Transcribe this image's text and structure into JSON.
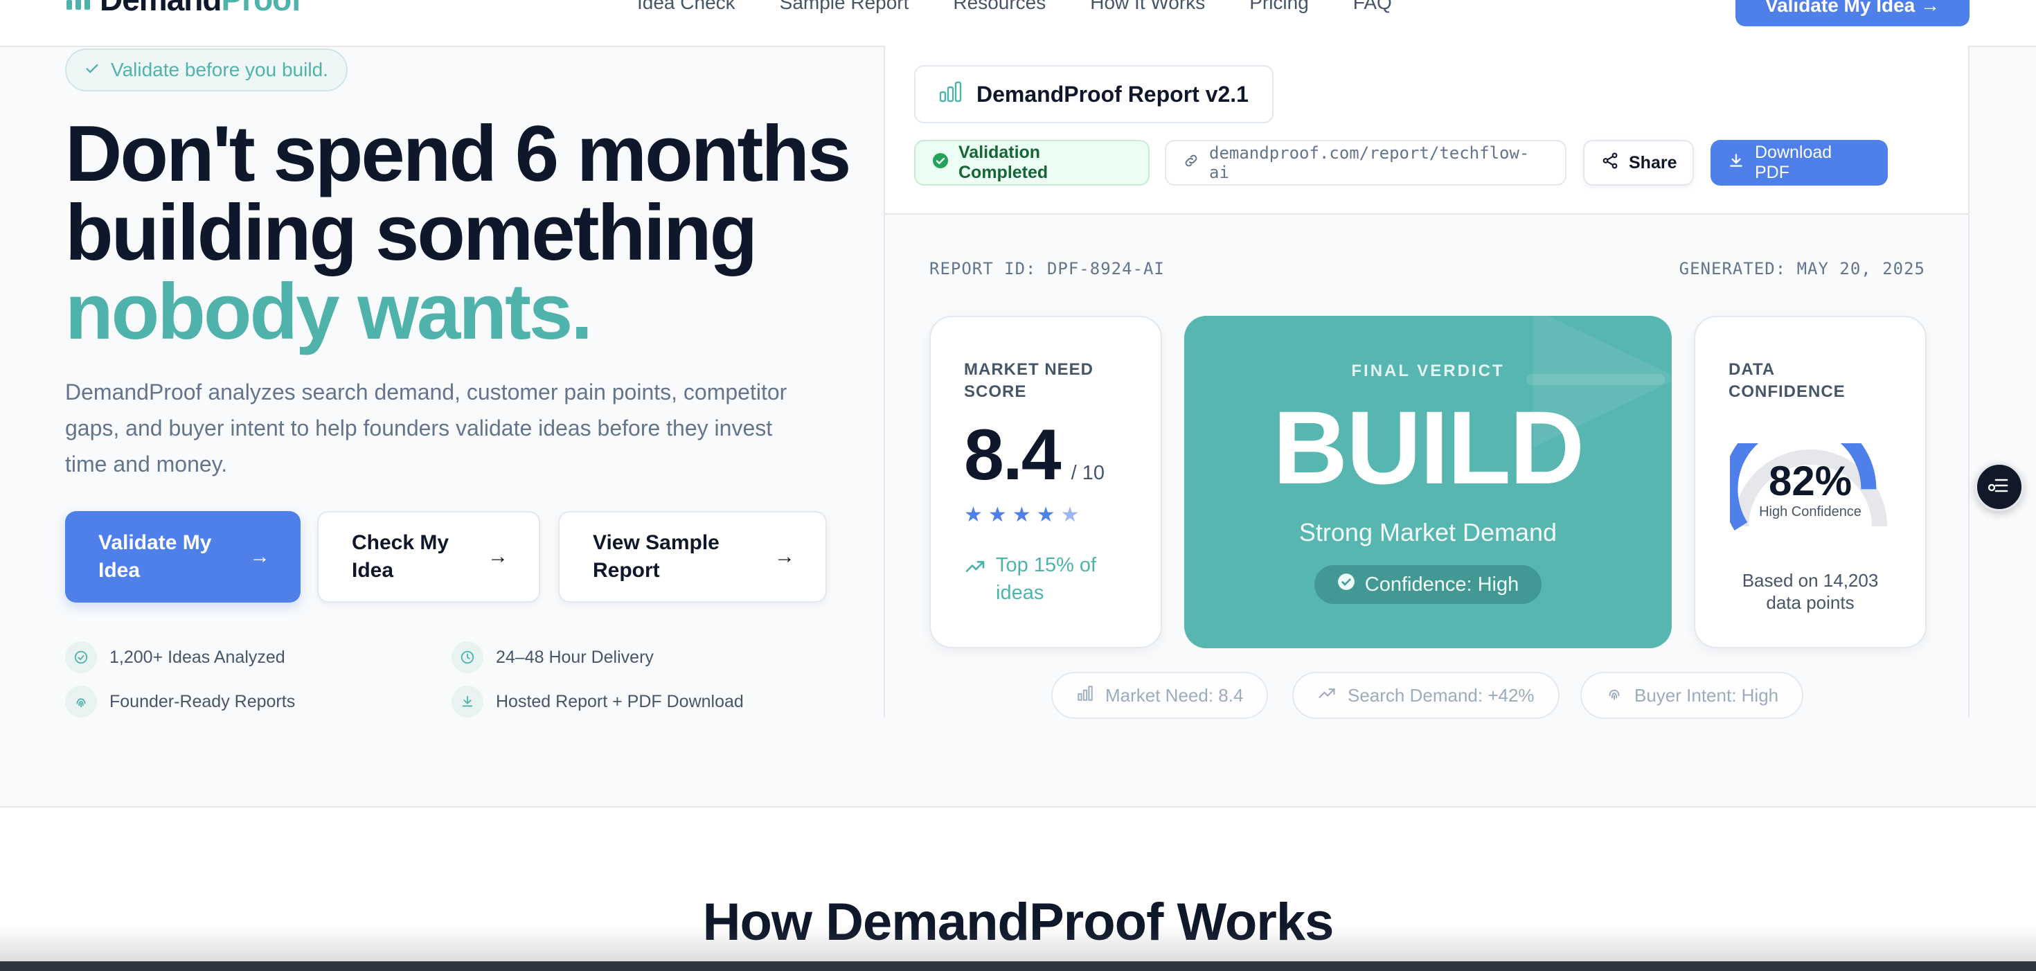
{
  "nav": {
    "brand_prefix": "Demand",
    "brand_accent": "Proof",
    "links": [
      "Idea Check",
      "Sample Report",
      "Resources",
      "How It Works",
      "Pricing",
      "FAQ"
    ],
    "cta": "Validate My Idea →"
  },
  "hero": {
    "pill": "Validate before you build.",
    "headline_line1": "Don't spend 6 months",
    "headline_line2": "building something",
    "headline_accent": "nobody wants.",
    "subcopy": "DemandProof analyzes search demand, customer pain points, competitor gaps, and buyer intent to help founders validate ideas before they invest time and money.",
    "buttons": {
      "primary": "Validate My Idea",
      "check": "Check My Idea",
      "sample": "View Sample Report",
      "arrow": "→"
    },
    "features": [
      {
        "label": "1,200+ Ideas Analyzed",
        "icon": "check-circle-icon"
      },
      {
        "label": "24–48 Hour Delivery",
        "icon": "clock-icon"
      },
      {
        "label": "Founder-Ready Reports",
        "icon": "fingerprint-icon"
      },
      {
        "label": "Hosted Report + PDF Download",
        "icon": "download-icon"
      }
    ]
  },
  "report": {
    "title": "DemandProof Report v2.1",
    "status": "Validation Completed",
    "url": "demandproof.com/report/techflow-ai",
    "share": "Share",
    "download": "Download PDF",
    "report_id": "REPORT ID: DPF-8924-AI",
    "generated": "GENERATED: MAY 20, 2025",
    "market_need": {
      "label_line1": "MARKET NEED",
      "label_line2": "SCORE",
      "value": "8.4",
      "max": "/ 10",
      "stars_filled": 4,
      "stars_total": 5,
      "trend_line1": "Top 15% of",
      "trend_line2": "ideas"
    },
    "verdict": {
      "label": "FINAL VERDICT",
      "value": "BUILD",
      "subtitle": "Strong Market Demand",
      "confidence": "Confidence: High"
    },
    "data_confidence": {
      "label_line1": "DATA",
      "label_line2": "CONFIDENCE",
      "value": "82%",
      "percent": 82,
      "sub": "High Confidence",
      "note_line1": "Based on 14,203",
      "note_line2": "data points"
    },
    "mini_stats": [
      "Market Need: 8.4",
      "Search Demand: +42%",
      "Buyer Intent: High"
    ]
  },
  "section2": {
    "title": "How DemandProof Works"
  },
  "colors": {
    "accent_teal": "#4fb3ab",
    "accent_blue": "#4f7fe8",
    "verdict_bg": "#57b6af",
    "text_dark": "#0f172a"
  }
}
